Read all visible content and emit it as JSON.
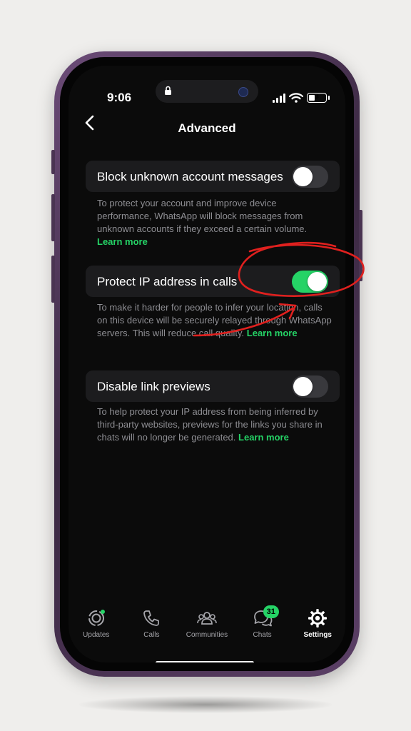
{
  "status_bar": {
    "time": "9:06",
    "battery": "3"
  },
  "nav": {
    "back_icon": "chevron-left-icon",
    "title": "Advanced"
  },
  "settings": [
    {
      "label": "Block unknown account messages",
      "enabled": false,
      "description": "To protect your account and improve device performance, WhatsApp will block messages from unknown accounts if they exceed a certain volume.",
      "learn_more": "Learn more"
    },
    {
      "label": "Protect IP address in calls",
      "enabled": true,
      "description": "To make it harder for people to infer your location, calls on this device will be securely relayed through WhatsApp servers. This will reduce call quality.",
      "learn_more": "Learn more"
    },
    {
      "label": "Disable link previews",
      "enabled": false,
      "description": "To help protect your IP address from being inferred by third-party websites, previews for the links you share in chats will no longer be generated.",
      "learn_more": "Learn more"
    }
  ],
  "tabs": [
    {
      "label": "Updates",
      "icon": "updates-icon",
      "active": false
    },
    {
      "label": "Calls",
      "icon": "phone-icon",
      "active": false
    },
    {
      "label": "Communities",
      "icon": "communities-icon",
      "active": false
    },
    {
      "label": "Chats",
      "icon": "chat-bubbles-icon",
      "active": false,
      "badge": "31"
    },
    {
      "label": "Settings",
      "icon": "gear-icon",
      "active": true
    }
  ],
  "colors": {
    "accent": "#25d366",
    "annotation": "#e0201e",
    "toggle_off": "#39393d"
  }
}
